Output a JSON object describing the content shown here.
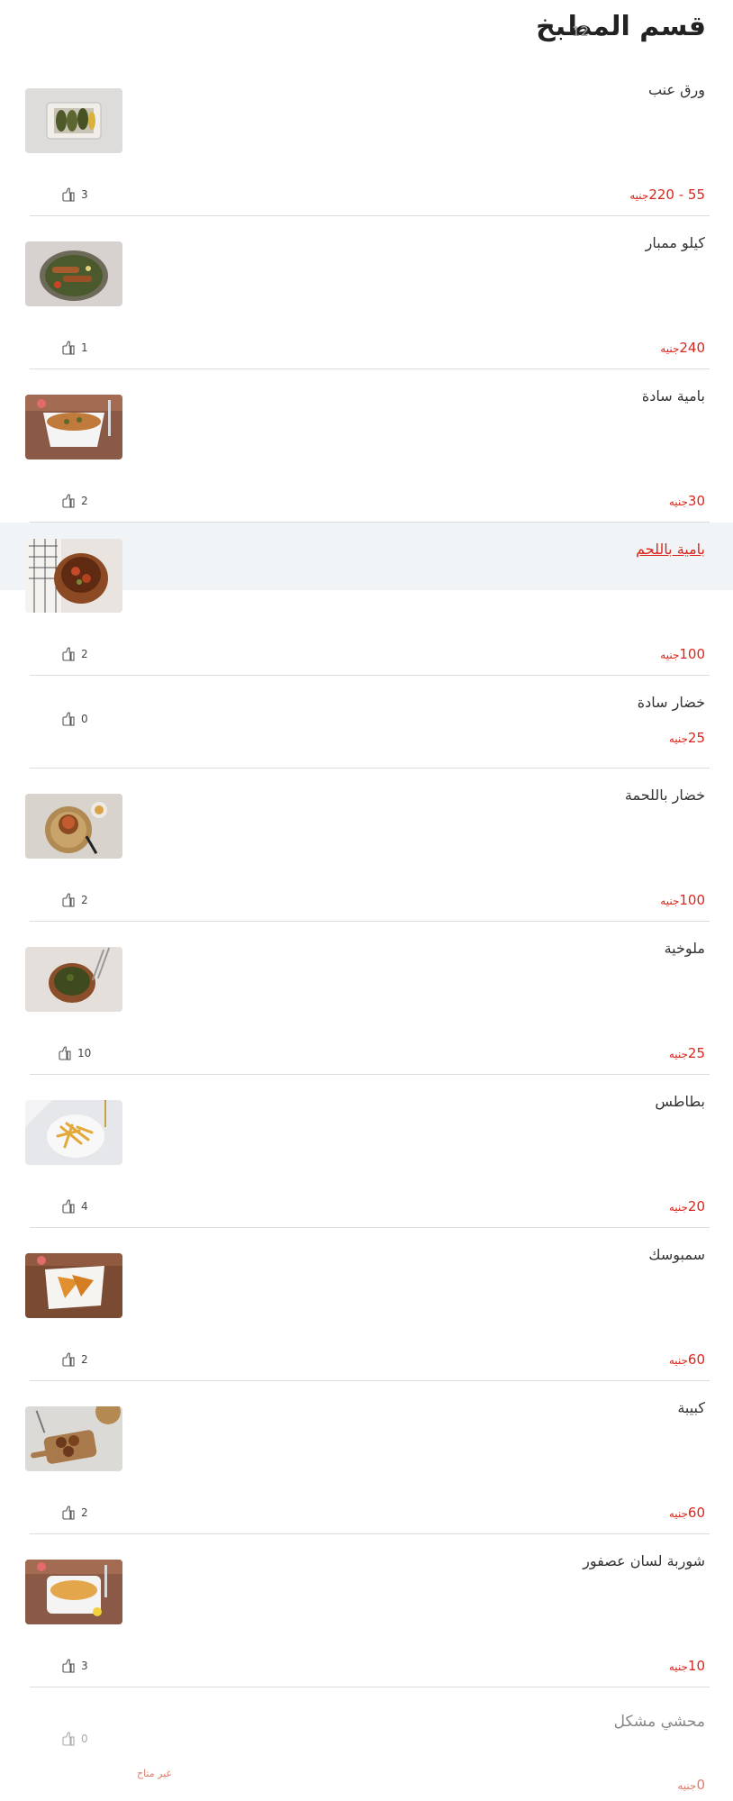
{
  "section": {
    "title": "قسم المطبخ",
    "count": "12"
  },
  "currency": "جنيه",
  "items": [
    {
      "name": "ورق عنب",
      "price": "55 - 220",
      "likes": "3",
      "image": "stuffed-grape-leaves"
    },
    {
      "name": "كيلو ممبار",
      "price": "240",
      "likes": "1",
      "image": "mombar-plate"
    },
    {
      "name": "بامية سادة",
      "price": "30",
      "likes": "2",
      "image": "okra-bowl"
    },
    {
      "name": "بامية باللحم",
      "price": "100",
      "likes": "2",
      "image": "okra-meat-clay-pot",
      "highlighted": true
    },
    {
      "name": "خضار سادة",
      "price": "25",
      "likes": "0"
    },
    {
      "name": "خضار باللحمة",
      "price": "100",
      "likes": "2",
      "image": "vegetables-meat-pot"
    },
    {
      "name": "ملوخية",
      "price": "25",
      "likes": "10",
      "image": "molokhia-pot"
    },
    {
      "name": "بطاطس",
      "price": "20",
      "likes": "4",
      "image": "fries-plate"
    },
    {
      "name": "سمبوسك",
      "price": "60",
      "likes": "2",
      "image": "sambousek-plate"
    },
    {
      "name": "كبيبة",
      "price": "60",
      "likes": "2",
      "image": "kobeiba-board"
    },
    {
      "name": "شوربة لسان عصفور",
      "price": "10",
      "likes": "3",
      "image": "orzo-soup-bowl"
    },
    {
      "name": "محشي مشكل",
      "price": "0",
      "likes": "0",
      "unavailable": "غير متاح"
    }
  ],
  "colors": {
    "price": "#d9261c",
    "highlight_bg": "#f1f4f7",
    "divider": "#dcdcdc"
  }
}
